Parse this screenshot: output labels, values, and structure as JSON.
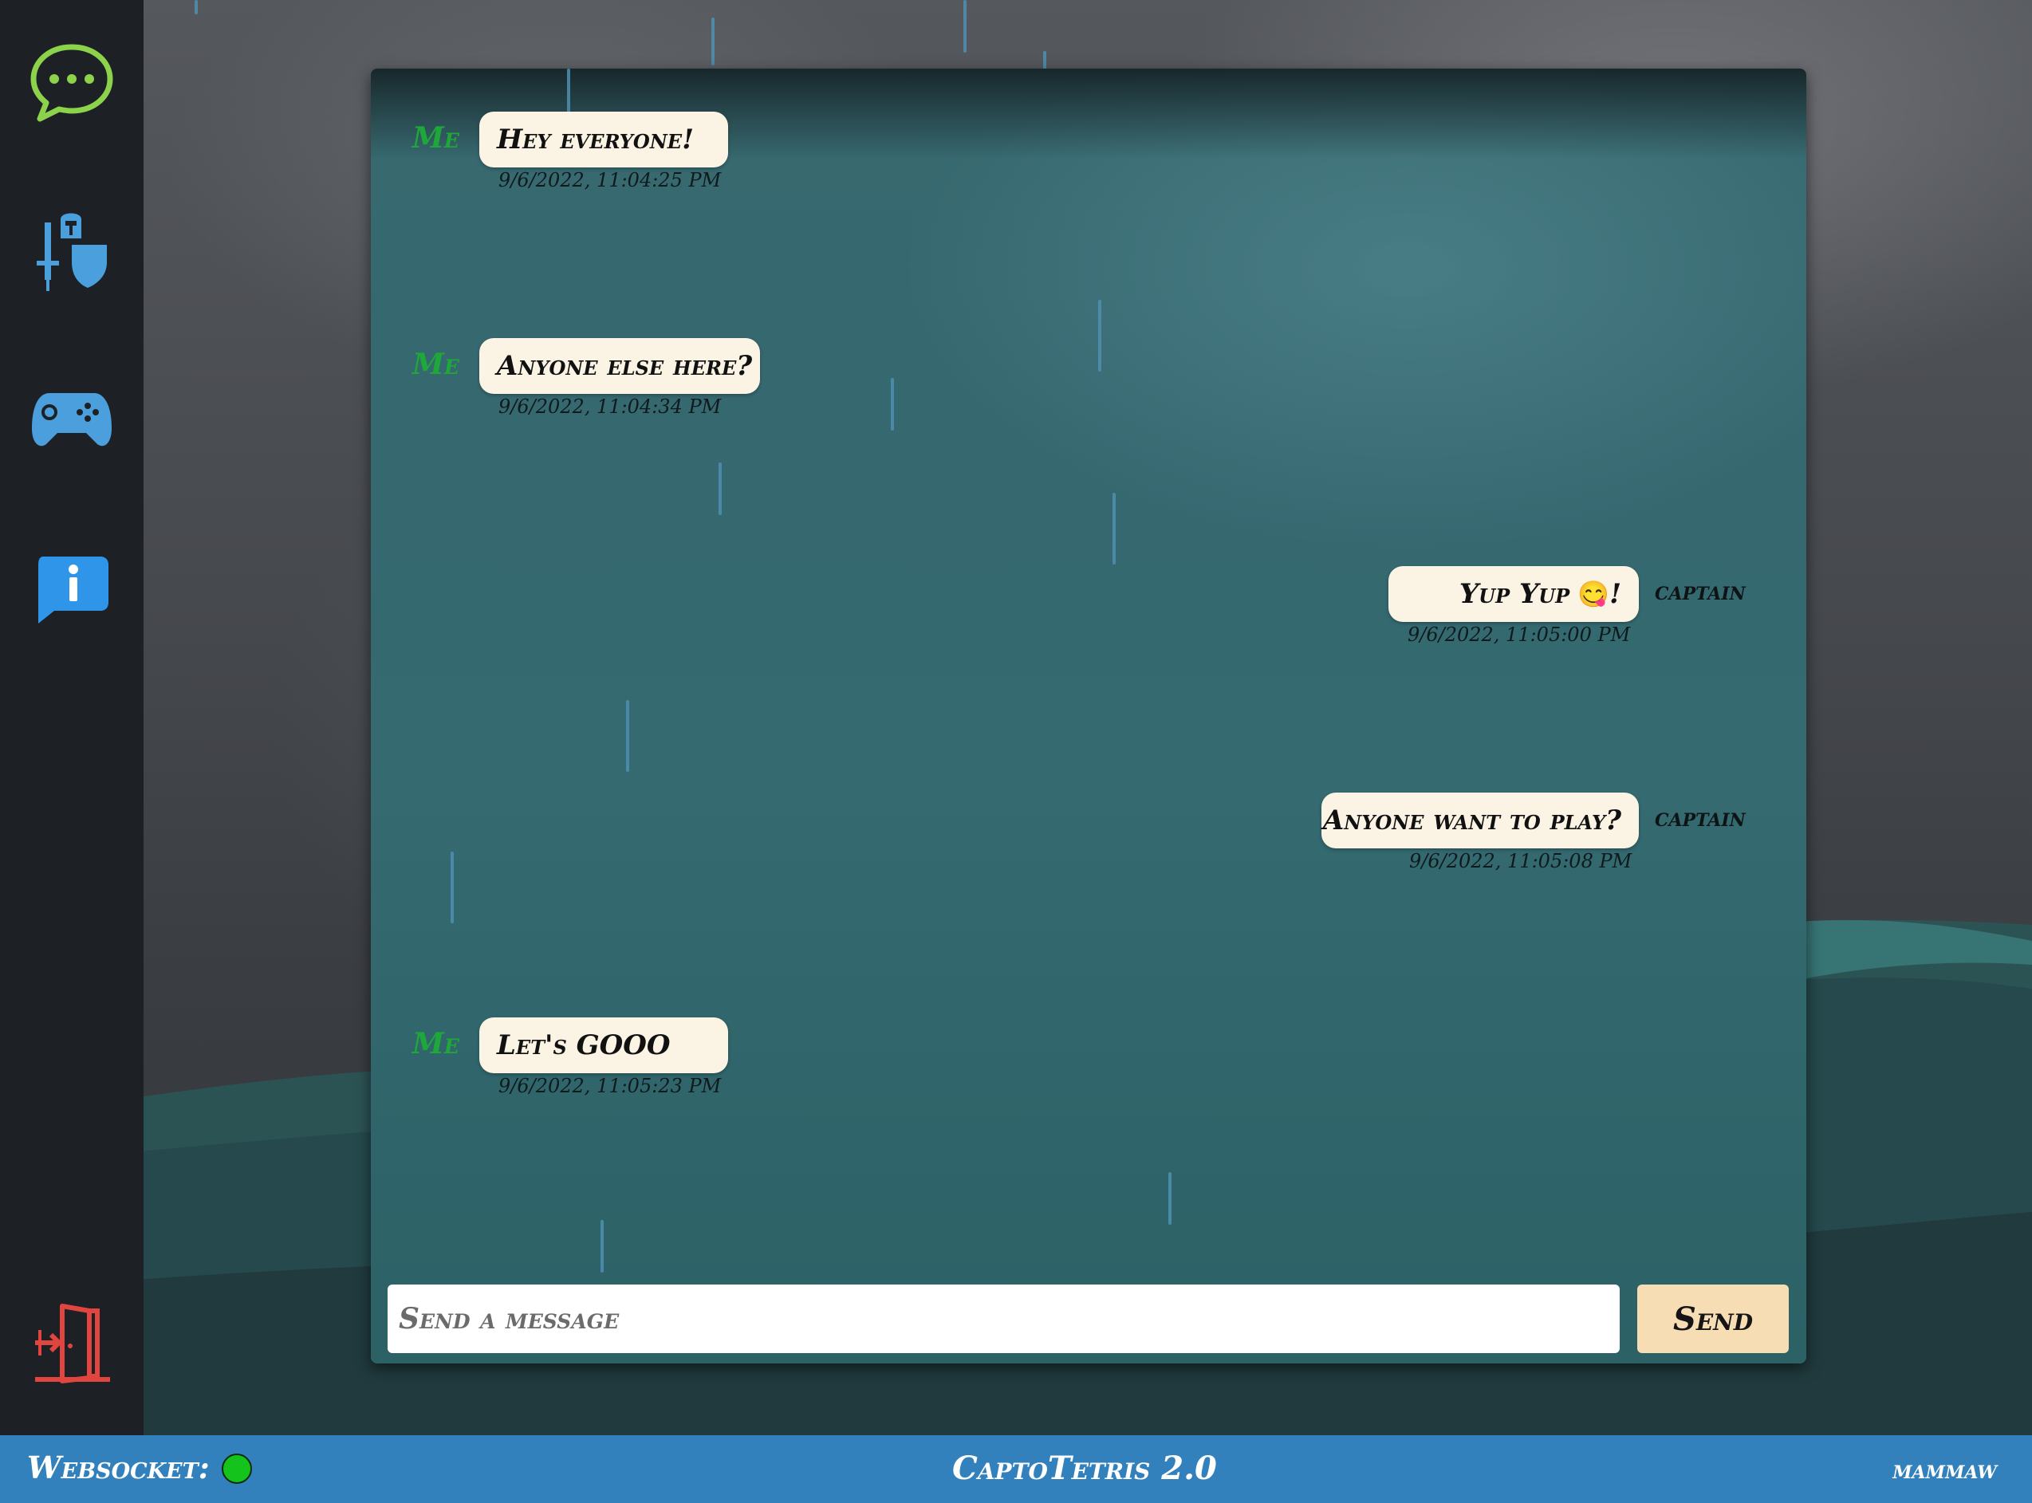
{
  "sidebar": {
    "items": [
      {
        "name": "chat-bubble-icon",
        "label": "Chat",
        "color": "#8cd24a"
      },
      {
        "name": "knight-helmet-icon",
        "label": "Battle",
        "color": "#4a9fdc"
      },
      {
        "name": "gamepad-icon",
        "label": "Play",
        "color": "#4a9fdc"
      },
      {
        "name": "info-icon",
        "label": "Info",
        "color": "#2f95e8"
      }
    ],
    "logout": {
      "name": "exit-door-icon",
      "color": "#e0463f"
    }
  },
  "chat": {
    "messages": [
      {
        "sender": "Me",
        "text": "Hey everyone!",
        "timestamp": "9/6/2022, 11:04:25 PM",
        "own": true
      },
      {
        "sender": "Me",
        "text": "Anyone else here?",
        "timestamp": "9/6/2022, 11:04:34 PM",
        "own": true
      },
      {
        "sender": "captain",
        "text": "Yup Yup",
        "emoji": "😋",
        "suffix": "!",
        "timestamp": "9/6/2022, 11:05:00 PM",
        "own": false
      },
      {
        "sender": "captain",
        "text": "Anyone want to play?",
        "timestamp": "9/6/2022, 11:05:08 PM",
        "own": false
      },
      {
        "sender": "Me",
        "text": "Let's GOOO",
        "timestamp": "9/6/2022, 11:05:23 PM",
        "own": true
      }
    ],
    "input": {
      "placeholder": "Send a message",
      "value": ""
    },
    "send_label": "Send"
  },
  "footer": {
    "websocket_label": "Websocket:",
    "websocket_status": "connected",
    "websocket_color": "#14c41d",
    "app_title": "CaptoTetris 2.0",
    "username": "mammaw"
  }
}
